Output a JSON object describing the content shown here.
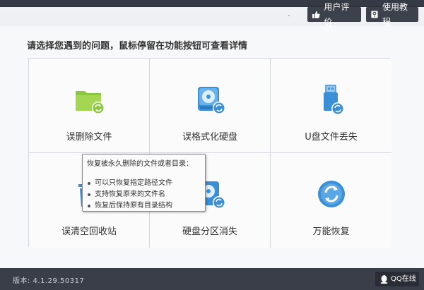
{
  "header": {
    "review_button": "用户评价",
    "tutorial_button": "使用教程"
  },
  "main": {
    "prompt": "请选择您遇到的问题，鼠标停留在功能按钮可查看详情",
    "options": [
      {
        "label": "误删除文件",
        "icon": "folder-recover-icon",
        "color": "#8cc63f"
      },
      {
        "label": "误格式化硬盘",
        "icon": "disk-format-recover-icon",
        "color": "#3a8fd6"
      },
      {
        "label": "U盘文件丢失",
        "icon": "usb-recover-icon",
        "color": "#3a8fd6"
      },
      {
        "label": "误清空回收站",
        "icon": "recycle-bin-recover-icon",
        "color": "#3a8fd6"
      },
      {
        "label": "硬盘分区消失",
        "icon": "partition-recover-icon",
        "color": "#3a8fd6"
      },
      {
        "label": "万能恢复",
        "icon": "universal-recover-icon",
        "color": "#3a8fd6"
      }
    ]
  },
  "tooltip": {
    "title": "恢复被永久删除的文件或者目录：",
    "items": [
      "可以只恢复指定路径文件",
      "支持恢复原来的文件名",
      "恢复后保持原有目录结构"
    ]
  },
  "footer": {
    "version": "版本: 4.1.29.50317",
    "qq_button": "QQ在线"
  }
}
